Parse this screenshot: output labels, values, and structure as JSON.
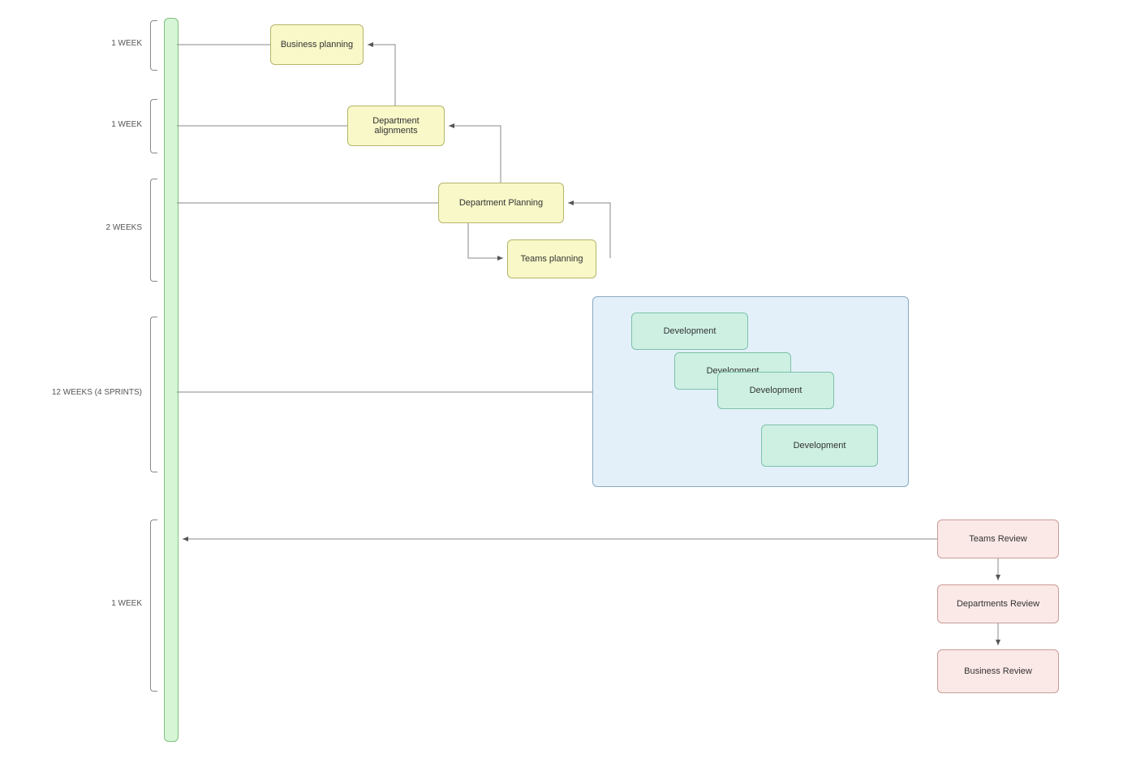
{
  "diagram": {
    "type": "process-flow-timeline",
    "timeline": {
      "phases": [
        {
          "label": "1 WEEK"
        },
        {
          "label": "1 WEEK"
        },
        {
          "label": "2 WEEKS"
        },
        {
          "label": "12 WEEKS (4 SPRINTS)"
        },
        {
          "label": "1 WEEK"
        }
      ]
    },
    "planning_boxes": {
      "business_planning": "Business planning",
      "department_alignments": "Department alignments",
      "department_planning": "Department Planning",
      "teams_planning": "Teams planning"
    },
    "development": {
      "sprints": [
        {
          "label": "Development"
        },
        {
          "label": "Development"
        },
        {
          "label": "Development"
        },
        {
          "label": "Development"
        }
      ]
    },
    "review_boxes": {
      "teams_review": "Teams Review",
      "departments_review": "Departments Review",
      "business_review": "Business Review"
    },
    "colors": {
      "timeline": "#d5f5d5",
      "planning": "#f8f8c8",
      "dev_container": "#e3f0fa",
      "dev_sprint": "#cdf0e3",
      "review": "#fbe9e7"
    }
  }
}
